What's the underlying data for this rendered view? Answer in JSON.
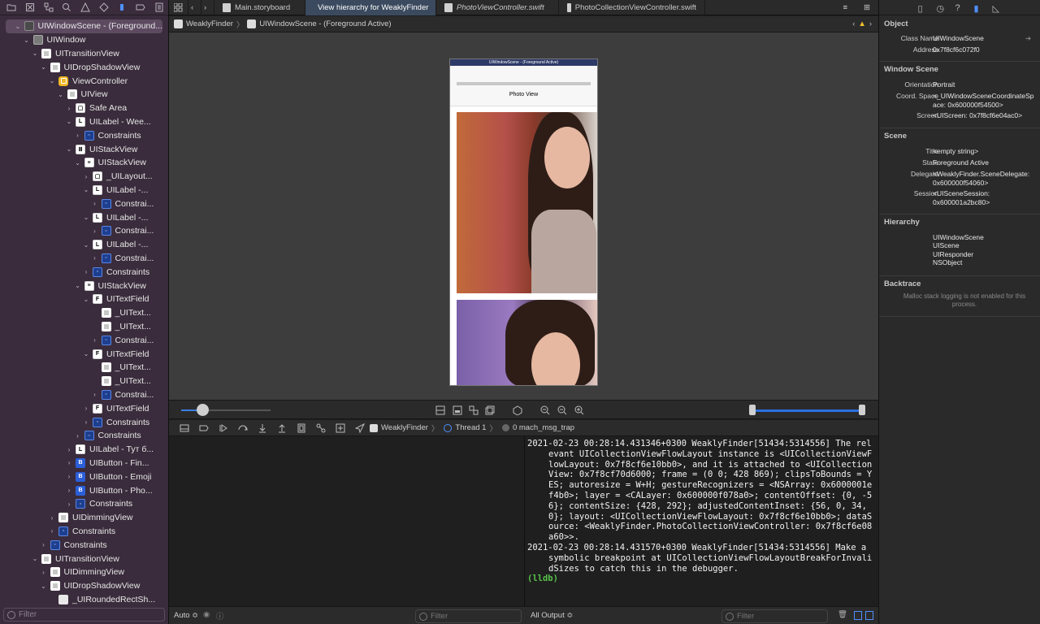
{
  "navigator": {
    "filter_placeholder": "Filter",
    "tree": [
      {
        "label": "UIWindowScene - (Foreground...",
        "depth": 0,
        "icon": "scene",
        "glyph": "",
        "disclosure": "open",
        "selected": true
      },
      {
        "label": "UIWindow",
        "depth": 1,
        "icon": "gray",
        "glyph": "",
        "disclosure": "open"
      },
      {
        "label": "UITransitionView",
        "depth": 2,
        "icon": "white",
        "glyph": "",
        "disclosure": "open"
      },
      {
        "label": "UIDropShadowView",
        "depth": 3,
        "icon": "white",
        "glyph": "",
        "disclosure": "open"
      },
      {
        "label": "ViewController",
        "depth": 4,
        "icon": "vc",
        "glyph": "",
        "disclosure": "open"
      },
      {
        "label": "UIView",
        "depth": 5,
        "icon": "white",
        "glyph": "",
        "disclosure": "open"
      },
      {
        "label": "Safe Area",
        "depth": 6,
        "icon": "stack",
        "glyph": "▢",
        "disclosure": "closed"
      },
      {
        "label": "UILabel - Wee...",
        "depth": 6,
        "icon": "letter",
        "glyph": "L",
        "disclosure": "open"
      },
      {
        "label": "Constraints",
        "depth": 7,
        "icon": "constr",
        "glyph": "▫",
        "disclosure": "closed"
      },
      {
        "label": "UIStackView",
        "depth": 6,
        "icon": "stack",
        "glyph": "Ⅲ",
        "disclosure": "open"
      },
      {
        "label": "UIStackView",
        "depth": 7,
        "icon": "stack",
        "glyph": "≡",
        "disclosure": "open"
      },
      {
        "label": "_UILayout...",
        "depth": 8,
        "icon": "stack",
        "glyph": "▢",
        "disclosure": "closed"
      },
      {
        "label": "UILabel -...",
        "depth": 8,
        "icon": "letter",
        "glyph": "L",
        "disclosure": "open"
      },
      {
        "label": "Constrai...",
        "depth": 9,
        "icon": "constr",
        "glyph": "▫",
        "disclosure": "closed"
      },
      {
        "label": "UILabel -...",
        "depth": 8,
        "icon": "letter",
        "glyph": "L",
        "disclosure": "open"
      },
      {
        "label": "Constrai...",
        "depth": 9,
        "icon": "constr",
        "glyph": "▫",
        "disclosure": "closed"
      },
      {
        "label": "UILabel -...",
        "depth": 8,
        "icon": "letter",
        "glyph": "L",
        "disclosure": "open"
      },
      {
        "label": "Constrai...",
        "depth": 9,
        "icon": "constr",
        "glyph": "▫",
        "disclosure": "closed"
      },
      {
        "label": "Constraints",
        "depth": 8,
        "icon": "constr",
        "glyph": "▫",
        "disclosure": "closed"
      },
      {
        "label": "UIStackView",
        "depth": 7,
        "icon": "stack",
        "glyph": "≡",
        "disclosure": "open"
      },
      {
        "label": "UITextField",
        "depth": 8,
        "icon": "letter",
        "glyph": "F",
        "disclosure": "open"
      },
      {
        "label": "_UIText...",
        "depth": 9,
        "icon": "white",
        "glyph": "",
        "disclosure": "none"
      },
      {
        "label": "_UIText...",
        "depth": 9,
        "icon": "white",
        "glyph": "",
        "disclosure": "none"
      },
      {
        "label": "Constrai...",
        "depth": 9,
        "icon": "constr",
        "glyph": "▫",
        "disclosure": "closed"
      },
      {
        "label": "UITextField",
        "depth": 8,
        "icon": "letter",
        "glyph": "F",
        "disclosure": "open"
      },
      {
        "label": "_UIText...",
        "depth": 9,
        "icon": "white",
        "glyph": "",
        "disclosure": "none"
      },
      {
        "label": "_UIText...",
        "depth": 9,
        "icon": "white",
        "glyph": "",
        "disclosure": "none"
      },
      {
        "label": "Constrai...",
        "depth": 9,
        "icon": "constr",
        "glyph": "▫",
        "disclosure": "closed"
      },
      {
        "label": "UITextField",
        "depth": 8,
        "icon": "letter",
        "glyph": "F",
        "disclosure": "closed"
      },
      {
        "label": "Constraints",
        "depth": 8,
        "icon": "constr",
        "glyph": "▫",
        "disclosure": "closed"
      },
      {
        "label": "Constraints",
        "depth": 7,
        "icon": "constr",
        "glyph": "▫",
        "disclosure": "closed"
      },
      {
        "label": "UILabel - Тут б...",
        "depth": 6,
        "icon": "letter",
        "glyph": "L",
        "disclosure": "closed"
      },
      {
        "label": "UIButton - Fin...",
        "depth": 6,
        "icon": "btn",
        "glyph": "B",
        "disclosure": "closed"
      },
      {
        "label": "UIButton - Emoji",
        "depth": 6,
        "icon": "btn",
        "glyph": "B",
        "disclosure": "closed"
      },
      {
        "label": "UIButton - Pho...",
        "depth": 6,
        "icon": "btn",
        "glyph": "B",
        "disclosure": "closed"
      },
      {
        "label": "Constraints",
        "depth": 6,
        "icon": "constr",
        "glyph": "▫",
        "disclosure": "closed"
      },
      {
        "label": "UIDimmingView",
        "depth": 4,
        "icon": "white",
        "glyph": "",
        "disclosure": "closed"
      },
      {
        "label": "Constraints",
        "depth": 4,
        "icon": "constr",
        "glyph": "▫",
        "disclosure": "closed"
      },
      {
        "label": "Constraints",
        "depth": 3,
        "icon": "constr",
        "glyph": "▫",
        "disclosure": "closed"
      },
      {
        "label": "UITransitionView",
        "depth": 2,
        "icon": "white",
        "glyph": "",
        "disclosure": "open"
      },
      {
        "label": "UIDimmingView",
        "depth": 3,
        "icon": "white",
        "glyph": "",
        "disclosure": "closed"
      },
      {
        "label": "UIDropShadowView",
        "depth": 3,
        "icon": "white",
        "glyph": "",
        "disclosure": "open"
      },
      {
        "label": "_UIRoundedRectSh...",
        "depth": 4,
        "icon": "img",
        "glyph": "",
        "disclosure": "none"
      }
    ]
  },
  "tabs": [
    {
      "label": "Main.storyboard",
      "active": false,
      "italic": false
    },
    {
      "label": "View hierarchy for WeaklyFinder",
      "active": true,
      "italic": false
    },
    {
      "label": "PhotoViewController.swift",
      "active": false,
      "italic": true
    },
    {
      "label": "PhotoCollectionViewController.swift",
      "active": false,
      "italic": false
    }
  ],
  "jumpbar": {
    "app": "WeaklyFinder",
    "scene": "UIWindowScene - (Foreground Active)"
  },
  "device": {
    "window_title": "UIWindowScene - (Foreground Active)",
    "nav_title": "Photo View"
  },
  "debugbar": {
    "app": "WeaklyFinder",
    "thread": "Thread 1",
    "frame": "0 mach_msg_trap"
  },
  "console": {
    "entries": [
      "2021-02-23 00:28:14.431346+0300 WeaklyFinder[51434:5314556] The relevant UICollectionViewFlowLayout instance is <UICollectionViewFlowLayout: 0x7f8cf6e10bb0>, and it is attached to <UICollectionView: 0x7f8cf70d6000; frame = (0 0; 428 869); clipsToBounds = YES; autoresize = W+H; gestureRecognizers = <NSArray: 0x6000001ef4b0>; layer = <CALayer: 0x600000f078a0>; contentOffset: {0, -56}; contentSize: {428, 292}; adjustedContentInset: {56, 0, 34, 0}; layout: <UICollectionViewFlowLayout: 0x7f8cf6e10bb0>; dataSource: <WeaklyFinder.PhotoCollectionViewController: 0x7f8cf6e08a60>>.",
      "2021-02-23 00:28:14.431570+0300 WeaklyFinder[51434:5314556] Make a symbolic breakpoint at UICollectionViewFlowLayoutBreakForInvalidSizes to catch this in the debugger."
    ],
    "prompt": "(lldb)"
  },
  "bottombar": {
    "auto_label": "Auto ≎",
    "filter_placeholder": "Filter",
    "output_label": "All Output ≎",
    "console_filter_placeholder": "Filter"
  },
  "inspector": {
    "object": {
      "title": "Object",
      "class_name_label": "Class Name",
      "class_name": "UIWindowScene",
      "address_label": "Address",
      "address": "0x7f8cf6c072f0"
    },
    "window_scene": {
      "title": "Window Scene",
      "orientation_label": "Orientation",
      "orientation": "Portrait",
      "coord_label": "Coord. Space",
      "coord": "<_UIWindowSceneCoordinateSpace: 0x600000f54500>",
      "screen_label": "Screen",
      "screen": "<UIScreen: 0x7f8cf6e04ac0>"
    },
    "scene": {
      "title": "Scene",
      "title_label": "Title",
      "title_value": "<empty string>",
      "state_label": "State",
      "state": "Foreground Active",
      "delegate_label": "Delegate",
      "delegate": "<WeaklyFinder.SceneDelegate: 0x600000f54060>",
      "session_label": "Session",
      "session": "<UISceneSession: 0x600001a2bc80>"
    },
    "hierarchy": {
      "title": "Hierarchy",
      "items": [
        "UIWindowScene",
        "UIScene",
        "UIResponder",
        "NSObject"
      ]
    },
    "backtrace": {
      "title": "Backtrace",
      "message": "Malloc stack logging is not enabled for this process."
    }
  }
}
